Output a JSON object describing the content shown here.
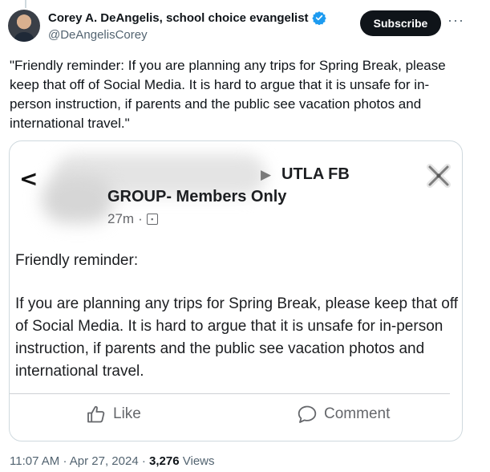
{
  "author": {
    "display_name": "Corey A. DeAngelis, school choice evangelist",
    "handle": "@DeAngelisCorey",
    "verified_badge_color": "#1d9bf0"
  },
  "actions": {
    "subscribe_label": "Subscribe",
    "more_label": "···"
  },
  "tweet": {
    "text": "\"Friendly reminder: If you are planning any trips for Spring Break, please keep that off of Social Media. It is hard to argue that it is unsafe for in-person instruction, if parents and the public see vacation photos and international travel.\""
  },
  "embedded_post": {
    "back_glyph": "<",
    "arrow_glyph": "▶",
    "group_line1": "UTLA FB",
    "group_line2": "GROUP- Members Only",
    "time": "27m",
    "separator": "·",
    "greeting": "Friendly reminder:",
    "body": "If you are planning any trips for Spring Break, please keep that off of Social Media.  It is hard to argue that it is unsafe for in-person instruction, if parents and the public see vacation photos and international travel.",
    "like_label": "Like",
    "comment_label": "Comment"
  },
  "meta": {
    "time": "11:07 AM",
    "date": "Apr 27, 2024",
    "separator": "·",
    "views_count": "3,276",
    "views_label": "Views"
  },
  "colors": {
    "text_primary": "#0f1419",
    "text_secondary": "#536471",
    "subscribe_bg": "#0f1419",
    "card_border": "#cfd9de",
    "fb_text": "#1c1e21",
    "fb_secondary": "#65676b"
  },
  "icons": [
    "verified-badge-icon",
    "more-icon",
    "back-chevron-icon",
    "group-arrow-icon",
    "audience-icon",
    "close-x-icon",
    "like-thumb-icon",
    "comment-bubble-icon"
  ]
}
